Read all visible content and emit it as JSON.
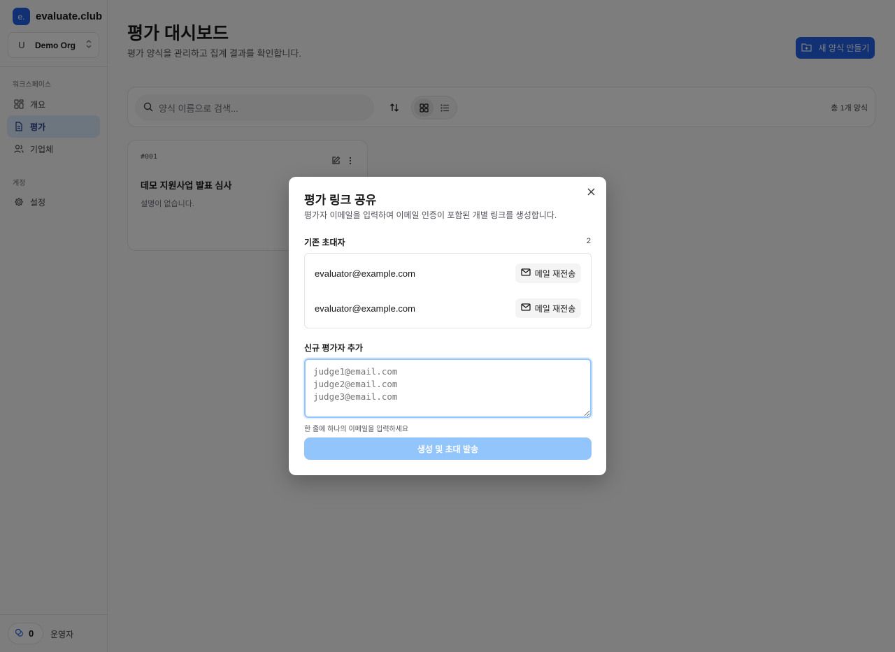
{
  "sidebar": {
    "brand_logo": "e.",
    "brand_name": "evaluate.club",
    "org": {
      "avatar": "U",
      "name": "Demo Org"
    },
    "workspace_label": "워크스페이스",
    "items": [
      {
        "label": "개요",
        "icon": "grid-icon"
      },
      {
        "label": "평가",
        "icon": "document-icon",
        "active": true
      },
      {
        "label": "기업체",
        "icon": "users-icon"
      }
    ],
    "account_label": "계정",
    "account_items": [
      {
        "label": "설정",
        "icon": "gear-icon"
      }
    ],
    "credits": "0",
    "role": "운영자"
  },
  "main": {
    "title": "평가 대시보드",
    "subtitle": "평가 양식을 관리하고 집계 결과를 확인합니다.",
    "new_button_label": "새 양식 만들기",
    "search_placeholder": "양식 이름으로 검색...",
    "count_label": "총 1개 양식",
    "cards": [
      {
        "number": "#001",
        "title": "데모 지원사업 발표 심사",
        "description": "설명이 없습니다."
      }
    ]
  },
  "modal": {
    "title": "평가 링크 공유",
    "description": "평가자 이메일을 입력하여 이메일 인증이 포함된 개별 링크를 생성합니다.",
    "existing_label": "기존 초대자",
    "existing_count": "2",
    "invitees": [
      {
        "email": "evaluator@example.com",
        "resend_label": "메일 재전송"
      },
      {
        "email": "evaluator@example.com",
        "resend_label": "메일 재전송"
      }
    ],
    "new_label": "신규 평가자 추가",
    "textarea_placeholder": "judge1@email.com\njudge2@email.com\njudge3@email.com",
    "hint": "한 줄에 하나의 이메일을 입력하세요",
    "submit_label": "생성 및 초대 발송"
  },
  "colors": {
    "accent": "#2563eb",
    "accent_light": "#93c5fd",
    "active_nav_bg": "#dbeafe",
    "overlay": "rgba(0,0,0,0.5)"
  }
}
